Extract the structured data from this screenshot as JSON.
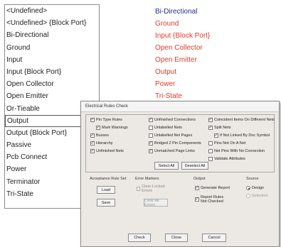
{
  "left_list": {
    "items": [
      "<Undefined>",
      "<Undefined> {Block Port}",
      "Bi-Directional",
      "Ground",
      "Input",
      "Input {Block Port}",
      "Open Collector",
      "Open Emitter",
      "Or-Tieable",
      "Output",
      "Output {Block Port}",
      "Passive",
      "Pcb Connect",
      "Power",
      "Terminator",
      "Tri-State"
    ],
    "selected": "Output"
  },
  "right_list": {
    "items": [
      "Bi-Directional",
      "Ground",
      "Input {Block Port}",
      "Open Collector",
      "Open Emitter",
      "Output",
      "Power",
      "Tri-State"
    ],
    "colors": {
      "first": "#2a2f8a",
      "others": "#e23b2b"
    }
  },
  "dialog": {
    "title": "Electrical Rules Check",
    "checks_col1": [
      "Pin Type Rules",
      "Mark Warnings",
      "Busses",
      "Hierarchy",
      "Unfinished Nets"
    ],
    "checks_col2": [
      "Unfinished Connections",
      "Unlabelled Nets",
      "Unlabelled Net Pages",
      "Bridged 2 Pin Components",
      "Unmatched Page Links"
    ],
    "checks_col3": [
      "Coincident Items On Different Nets",
      "Split Nets",
      "If Not Linked By Doc Symbol",
      "Pins Not On A Net",
      "Net Pins With No Connection",
      "Validate Attributes"
    ],
    "select_all": "Select All",
    "deselect_all": "Deselect All",
    "acceptance": {
      "label": "Acceptance Rule Set",
      "load": "Load",
      "save": "Save"
    },
    "error_markers": {
      "label": "Error Markers",
      "clear_locked": "Clear Locked Errors",
      "clear_all": "Clear All Errors"
    },
    "output": {
      "label": "Output",
      "generate_report": "Generate Report",
      "report_rules": "Report Rules Not Checked"
    },
    "source": {
      "label": "Source",
      "design": "Design",
      "selection": "Selection"
    },
    "check": "Check",
    "close": "Close",
    "cancel": "Cancel"
  }
}
